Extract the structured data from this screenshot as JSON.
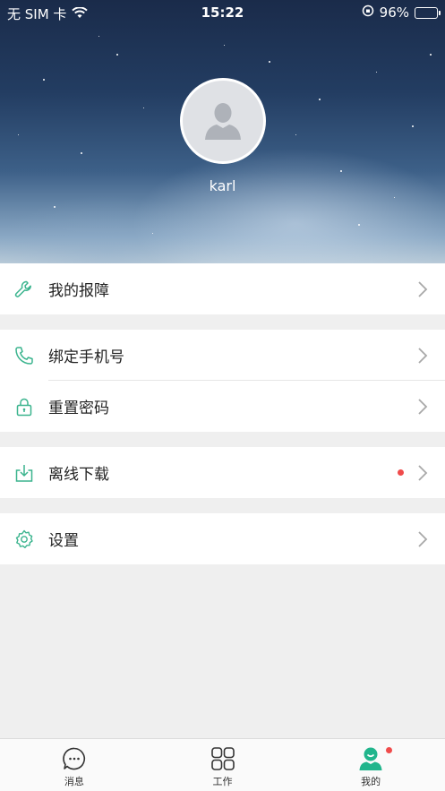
{
  "status_bar": {
    "carrier": "无 SIM 卡",
    "time": "15:22",
    "battery": "96%"
  },
  "profile": {
    "username": "karl"
  },
  "menu": {
    "repair": "我的报障",
    "bind_phone": "绑定手机号",
    "reset_password": "重置密码",
    "offline_download": "离线下载",
    "settings": "设置"
  },
  "tabbar": {
    "messages": "消息",
    "work": "工作",
    "mine": "我的"
  },
  "colors": {
    "accent": "#3bb48e",
    "badge": "#f04b4b"
  }
}
